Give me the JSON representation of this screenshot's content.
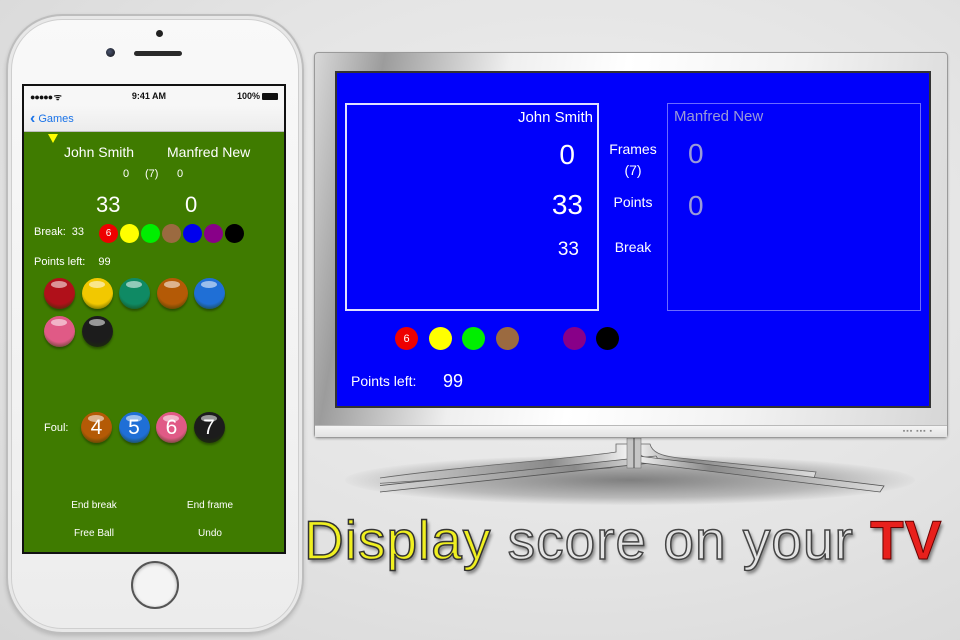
{
  "phone": {
    "statusbar": {
      "signal": "●●●●● ᯤ",
      "time": "9:41 AM",
      "battery": "100%"
    },
    "navbar": {
      "back_label": "Games"
    },
    "players": {
      "p1_name": "John Smith",
      "p2_name": "Manfred New"
    },
    "frames": {
      "p1": "0",
      "total": "(7)",
      "p2": "0"
    },
    "scores": {
      "p1": "33",
      "p2": "0"
    },
    "break": {
      "label": "Break:",
      "value": "33"
    },
    "break_balls": [
      {
        "color": "#ee0000",
        "label": "6"
      },
      {
        "color": "#ffff00",
        "label": ""
      },
      {
        "color": "#00ee00",
        "label": ""
      },
      {
        "color": "#9b6a40",
        "label": ""
      },
      {
        "color": "#0000ee",
        "label": ""
      },
      {
        "color": "#880088",
        "label": ""
      },
      {
        "color": "#000000",
        "label": ""
      }
    ],
    "points_left": {
      "label": "Points left:",
      "value": "99"
    },
    "pot_balls": [
      {
        "name": "red",
        "color": "#b0101a"
      },
      {
        "name": "yellow",
        "color": "#f2c800"
      },
      {
        "name": "green",
        "color": "#0f8a64"
      },
      {
        "name": "brown",
        "color": "#b45a06"
      },
      {
        "name": "blue",
        "color": "#1f6fd6"
      },
      {
        "name": "pink",
        "color": "#e05a86"
      },
      {
        "name": "black",
        "color": "#1c1c1c"
      }
    ],
    "foul": {
      "label": "Foul:",
      "balls": [
        {
          "label": "4",
          "color": "#b45a06"
        },
        {
          "label": "5",
          "color": "#1f6fd6"
        },
        {
          "label": "6",
          "color": "#e05a86"
        },
        {
          "label": "7",
          "color": "#1c1c1c"
        }
      ]
    },
    "buttons": {
      "end_break": "End break",
      "end_frame": "End frame",
      "free_ball": "Free Ball",
      "undo": "Undo"
    }
  },
  "tv": {
    "p1": {
      "name": "John Smith",
      "frames": "0",
      "points": "33",
      "break": "33"
    },
    "p2": {
      "name": "Manfred New",
      "frames": "0",
      "points": "0"
    },
    "labels": {
      "frames": "Frames",
      "frames_total": "(7)",
      "points": "Points",
      "break": "Break"
    },
    "break_balls": [
      {
        "color": "#ee0000",
        "label": "6"
      },
      {
        "color": "#ffff00",
        "label": ""
      },
      {
        "color": "#00ee00",
        "label": ""
      },
      {
        "color": "#9b6a40",
        "label": ""
      },
      {
        "color": "#0000fb",
        "label": ""
      },
      {
        "color": "#880088",
        "label": ""
      },
      {
        "color": "#000000",
        "label": ""
      }
    ],
    "points_left": {
      "label": "Points left:",
      "value": "99"
    },
    "leds": "▪▪▪ ▪▪▪ ▪"
  },
  "tagline": {
    "part1": "Display",
    "part2": " score on your ",
    "part3": "TV"
  },
  "colors": {
    "table_green": "#3f7b00",
    "tv_blue": "#0000fb",
    "accent_blue": "#1a73e8"
  }
}
